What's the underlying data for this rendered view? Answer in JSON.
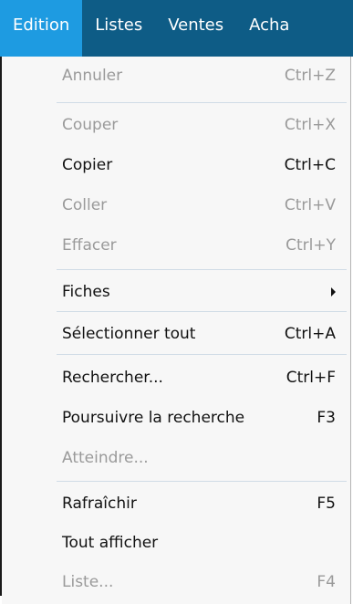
{
  "menubar": {
    "items": [
      {
        "label": "Edition"
      },
      {
        "label": "Listes"
      },
      {
        "label": "Ventes"
      },
      {
        "label": "Acha"
      }
    ]
  },
  "menu": {
    "items": [
      {
        "label": "Annuler",
        "shortcut": "Ctrl+Z",
        "enabled": false
      },
      {
        "label": "Couper",
        "shortcut": "Ctrl+X",
        "enabled": false
      },
      {
        "label": "Copier",
        "shortcut": "Ctrl+C",
        "enabled": true
      },
      {
        "label": "Coller",
        "shortcut": "Ctrl+V",
        "enabled": false
      },
      {
        "label": "Effacer",
        "shortcut": "Ctrl+Y",
        "enabled": false
      },
      {
        "label": "Fiches",
        "shortcut": "",
        "enabled": true,
        "submenu": true
      },
      {
        "label": "Sélectionner tout",
        "shortcut": "Ctrl+A",
        "enabled": true
      },
      {
        "label": "Rechercher...",
        "shortcut": "Ctrl+F",
        "enabled": true
      },
      {
        "label": "Poursuivre la recherche",
        "shortcut": "F3",
        "enabled": true
      },
      {
        "label": "Atteindre...",
        "shortcut": "",
        "enabled": false
      },
      {
        "label": "Rafraîchir",
        "shortcut": "F5",
        "enabled": true
      },
      {
        "label": "Tout afficher",
        "shortcut": "",
        "enabled": true
      },
      {
        "label": "Liste...",
        "shortcut": "F4",
        "enabled": false
      }
    ]
  }
}
